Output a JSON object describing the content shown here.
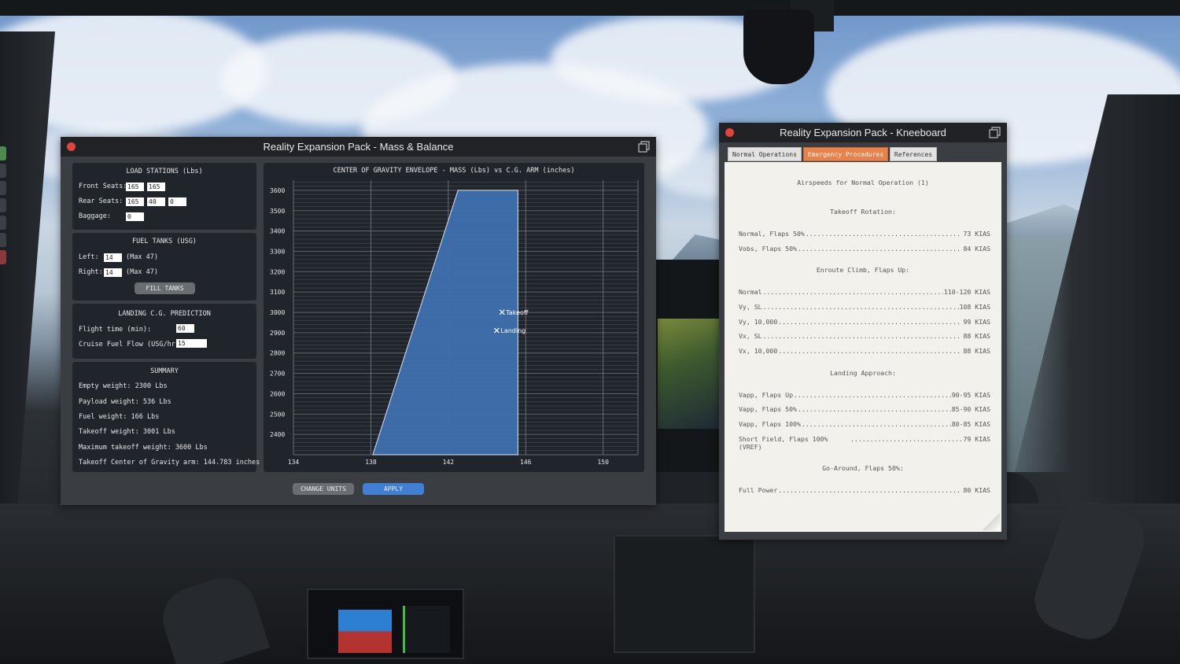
{
  "mass_balance": {
    "title": "Reality Expansion Pack - Mass & Balance",
    "load_stations": {
      "title": "LOAD STATIONS (Lbs)",
      "front_label": "Front Seats:",
      "front_values": [
        "165",
        "165"
      ],
      "rear_label": "Rear Seats:",
      "rear_values": [
        "165",
        "40",
        "0"
      ],
      "baggage_label": "Baggage:",
      "baggage_value": "0"
    },
    "fuel_tanks": {
      "title": "FUEL TANKS (USG)",
      "left_label": "Left:",
      "left_value": "14",
      "left_max": "(Max 47)",
      "right_label": "Right:",
      "right_value": "14",
      "right_max": "(Max 47)",
      "fill_button": "FILL TANKS"
    },
    "landing_cg": {
      "title": "LANDING C.G. PREDICTION",
      "flight_time_label": "Flight time (min):",
      "flight_time_value": "60",
      "fuel_flow_label": "Cruise Fuel Flow (USG/hr):",
      "fuel_flow_value": "15"
    },
    "summary": {
      "title": "SUMMARY",
      "lines": [
        "Empty weight: 2300 Lbs",
        "Payload weight: 536 Lbs",
        "Fuel weight: 166 Lbs",
        "Takeoff weight: 3001 Lbs",
        "Maximum takeoff weight: 3600 Lbs",
        "Takeoff Center of Gravity arm: 144.783 inches"
      ]
    },
    "buttons": {
      "change_units": "CHANGE UNITS",
      "apply": "APPLY"
    }
  },
  "chart_data": {
    "type": "area",
    "title": "CENTER OF GRAVITY ENVELOPE - MASS (Lbs) vs C.G. ARM (inches)",
    "x_ticks": [
      "134",
      "138",
      "142",
      "146",
      "150"
    ],
    "y_ticks": [
      "3600",
      "3500",
      "3400",
      "3300",
      "3200",
      "3100",
      "3000",
      "2900",
      "2800",
      "2700",
      "2600",
      "2500",
      "2400"
    ],
    "xlim": [
      134,
      151.8
    ],
    "ylim": [
      2300,
      3650
    ],
    "envelope": [
      [
        138.1,
        2300
      ],
      [
        142.5,
        3600
      ],
      [
        145.6,
        3600
      ],
      [
        145.6,
        2300
      ]
    ],
    "points": [
      {
        "name": "Takeoff",
        "x": 144.78,
        "y": 3001
      },
      {
        "name": "Landing",
        "x": 144.5,
        "y": 2911
      }
    ],
    "colors": {
      "envelope": "#3f6fae",
      "grid": "#6b7280",
      "text": "#e6e6e6"
    },
    "grid": true
  },
  "kneeboard": {
    "title": "Reality Expansion Pack - Kneeboard",
    "tabs": [
      {
        "label": "Normal Operations",
        "active": false
      },
      {
        "label": "Emergency Procedures",
        "active": true
      },
      {
        "label": "References",
        "active": false
      }
    ],
    "heading": "Airspeeds for Normal Operation (1)",
    "sections": {
      "takeoff": "Takeoff Rotation:",
      "enroute": "Enroute Climb, Flaps Up:",
      "landing": "Landing Approach:",
      "goaround": "Go-Around, Flaps 50%:"
    },
    "rows": [
      {
        "label": "Normal, Flaps 50%",
        "value": "73 KIAS"
      },
      {
        "label": "Vobs, Flaps 50%",
        "value": "84 KIAS"
      },
      {
        "label": "Normal",
        "value": "110-120 KIAS"
      },
      {
        "label": "Vy, SL",
        "value": "108 KIAS"
      },
      {
        "label": "Vy, 10,000",
        "value": "99 KIAS"
      },
      {
        "label": "Vx, SL",
        "value": "88 KIAS"
      },
      {
        "label": "Vx, 10,000",
        "value": "88 KIAS"
      },
      {
        "label": "Vapp, Flaps Up",
        "value": "90-95 KIAS"
      },
      {
        "label": "Vapp, Flaps 50%",
        "value": "85-90 KIAS"
      },
      {
        "label": "Vapp, Flaps 100%",
        "value": "80-85 KIAS"
      },
      {
        "label": "Short Field, Flaps 100%",
        "label2": "(VREF)",
        "value": "79 KIAS"
      },
      {
        "label": "Full Power",
        "value": "80 KIAS"
      }
    ]
  }
}
